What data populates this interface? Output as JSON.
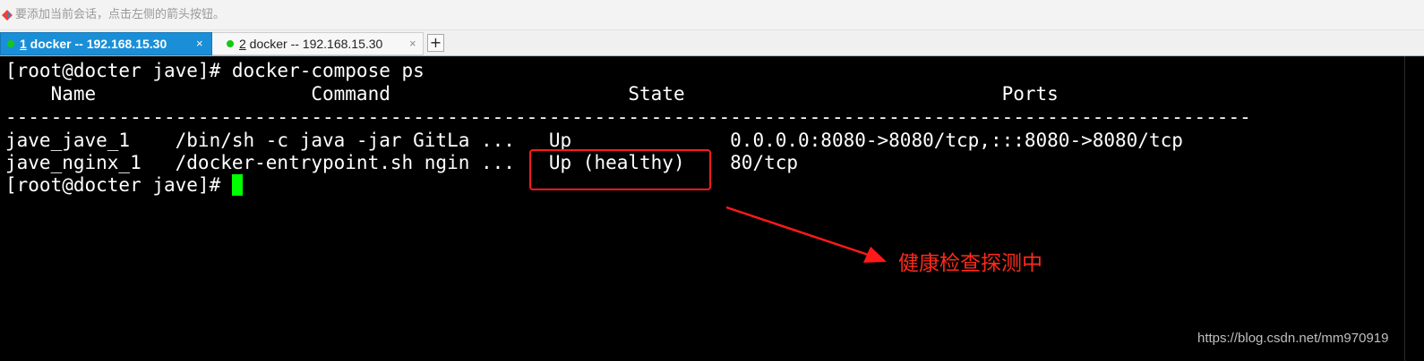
{
  "hint_bar": {
    "icon": "diamond-arrow-icon",
    "text": "要添加当前会话，点击左侧的箭头按钮。"
  },
  "tabs": [
    {
      "number": "1",
      "label": " docker -- 192.168.15.30",
      "close": "×",
      "active": true,
      "status": "connected",
      "status_color": "#14c814"
    },
    {
      "number": "2",
      "label": " docker -- 192.168.15.30",
      "close": "×",
      "active": false,
      "status": "connected",
      "status_color": "#14c814"
    }
  ],
  "add_tab": "+",
  "terminal": {
    "lines": [
      "[root@docter jave]# docker-compose ps",
      "    Name                   Command                     State                            Ports",
      "--------------------------------------------------------------------------------------------------------------",
      "jave_jave_1    /bin/sh -c java -jar GitLa ...   Up              0.0.0.0:8080->8080/tcp,:::8080->8080/tcp",
      "jave_nginx_1   /docker-entrypoint.sh ngin ...   Up (healthy)    80/tcp"
    ],
    "prompt": "[root@docter jave]# ",
    "cursor_color": "#00ff00"
  },
  "annotation": {
    "text": "健康检查探测中",
    "color": "#ff2a1a"
  },
  "watermark": "https://blog.csdn.net/mm970919"
}
